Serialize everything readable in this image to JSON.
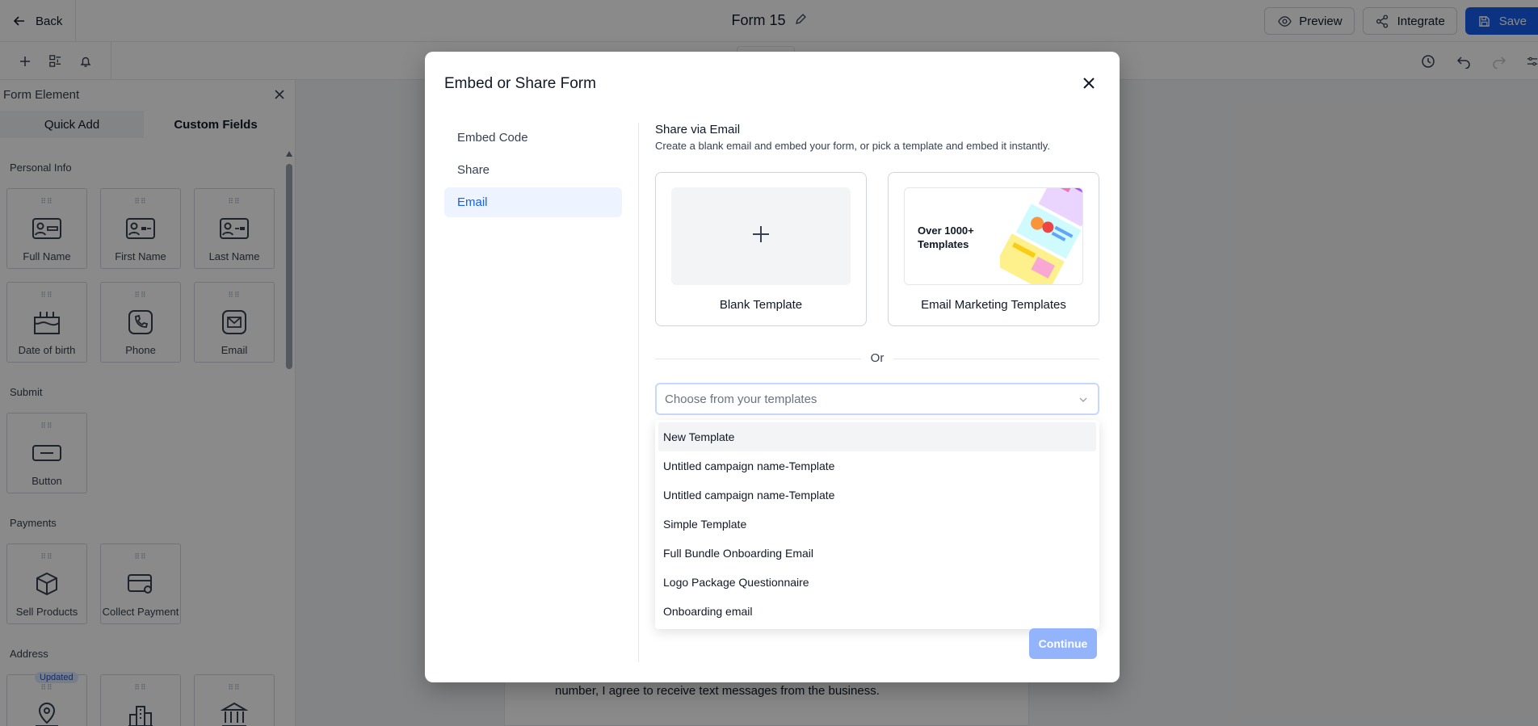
{
  "topbar": {
    "back_label": "Back",
    "form_title": "Form 15",
    "preview_label": "Preview",
    "integrate_label": "Integrate",
    "save_label": "Save"
  },
  "left_panel": {
    "title": "Form Element",
    "tabs": [
      "Quick Add",
      "Custom Fields"
    ],
    "sections": {
      "personal_info": "Personal Info",
      "submit": "Submit",
      "payments": "Payments",
      "address": "Address"
    },
    "tiles": {
      "full_name": "Full Name",
      "first_name": "First Name",
      "last_name": "Last Name",
      "date_of_birth": "Date of birth",
      "phone": "Phone",
      "email": "Email",
      "button": "Button",
      "sell_products": "Sell Products",
      "collect_payment": "Collect Payment"
    },
    "updated_badge": "Updated"
  },
  "canvas": {
    "consent_text": "number, I agree to receive text messages from the business."
  },
  "modal": {
    "title": "Embed or Share Form",
    "nav": [
      "Embed Code",
      "Share",
      "Email"
    ],
    "active_nav": "Email",
    "share_title": "Share via Email",
    "share_subtitle": "Create a blank email and embed your form, or pick a template and embed it instantly.",
    "blank_template_label": "Blank Template",
    "marketing_template_label": "Email Marketing Templates",
    "marketing_preview_text": "Over 1000+ Templates",
    "or_label": "Or",
    "select_placeholder": "Choose from your templates",
    "dropdown_options": [
      "New Template",
      "Untitled campaign name-Template",
      "Untitled campaign name-Template",
      "Simple Template",
      "Full Bundle Onboarding Email",
      "Logo Package Questionnaire",
      "Onboarding email"
    ],
    "continue_label": "Continue"
  },
  "colors": {
    "primary": "#155eef",
    "primary_disabled": "#93b4fb",
    "active_nav_bg": "#eef4ff"
  }
}
